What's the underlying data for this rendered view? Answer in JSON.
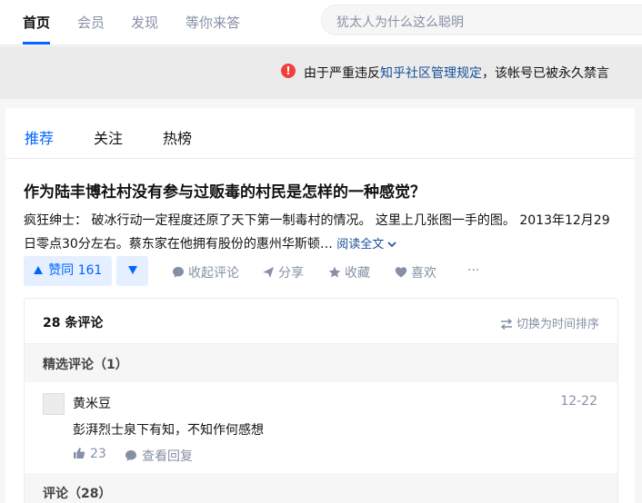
{
  "nav": {
    "items": [
      "首页",
      "会员",
      "发现",
      "等你来答"
    ],
    "search_placeholder": "犹太人为什么这么聪明"
  },
  "banner": {
    "text_before": "由于严重违反",
    "link": "知乎社区管理规定",
    "text_after": "，该帐号已被永久禁言"
  },
  "feed_tabs": [
    "推荐",
    "关注",
    "热榜"
  ],
  "question": {
    "title": "作为陆丰博社村没有参与过贩毒的村民是怎样的一种感觉？",
    "author": "疯狂绅士：",
    "excerpt": " 破冰行动一定程度还原了天下第一制毒村的情况。 这里上几张图一手的图。 2013年12月29日零点30分左右。蔡东家在他拥有股份的惠州华斯顿…",
    "read_more": "阅读全文"
  },
  "actions": {
    "upvote": "赞同 161",
    "comment": "收起评论",
    "share": "分享",
    "favorite": "收藏",
    "like": "喜欢",
    "more": "···"
  },
  "comments": {
    "count_label": "28 条评论",
    "sort_label": "切换为时间排序",
    "featured_label": "精选评论（1）",
    "all_label": "评论（28）",
    "items": [
      {
        "user": "黄米豆",
        "date": "12-22",
        "text": "彭湃烈士泉下有知，不知作何感想",
        "likes": "23",
        "reply": "查看回复"
      }
    ]
  },
  "colors": {
    "accent": "#0066ff",
    "link": "#175199",
    "warning": "#f1403c",
    "muted": "#8590a6"
  }
}
